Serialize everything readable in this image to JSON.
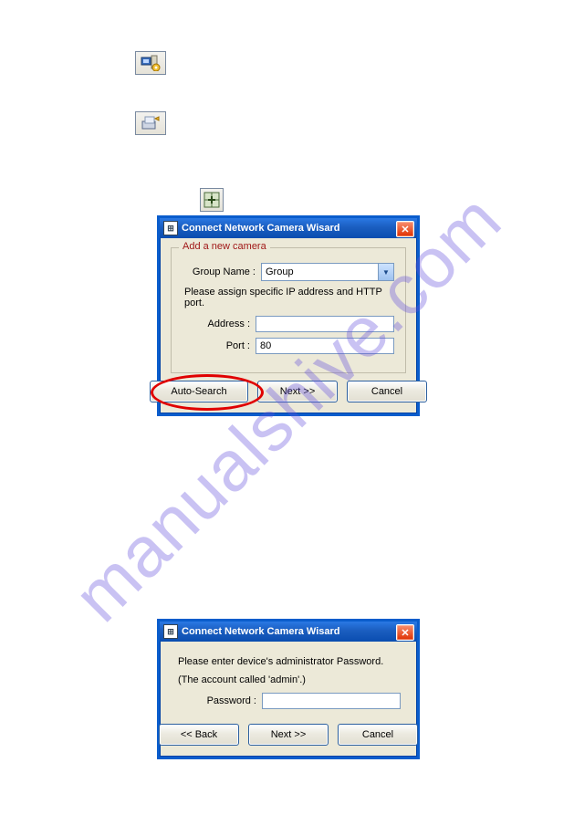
{
  "watermark": "manualshive.com",
  "icons": {
    "computer_gear": "computer-gear-icon",
    "scanner": "scanner-icon",
    "grid": "grid-plus-icon"
  },
  "dialog1": {
    "title": "Connect Network Camera Wisard",
    "legend": "Add a new camera",
    "group_label": "Group Name : ",
    "group_value": "Group",
    "instruct": "Please assign specific IP address and HTTP port.",
    "address_label": "Address : ",
    "address_value": "",
    "port_label": "Port : ",
    "port_value": "80",
    "btn_auto": "Auto-Search",
    "btn_next": "Next >>",
    "btn_cancel": "Cancel"
  },
  "dialog2": {
    "title": "Connect Network Camera Wisard",
    "line1": "Please enter device's administrator Password.",
    "line2": "(The account called 'admin'.)",
    "pw_label": "Password : ",
    "pw_value": "",
    "btn_back": "<< Back",
    "btn_next": "Next >>",
    "btn_cancel": "Cancel"
  }
}
